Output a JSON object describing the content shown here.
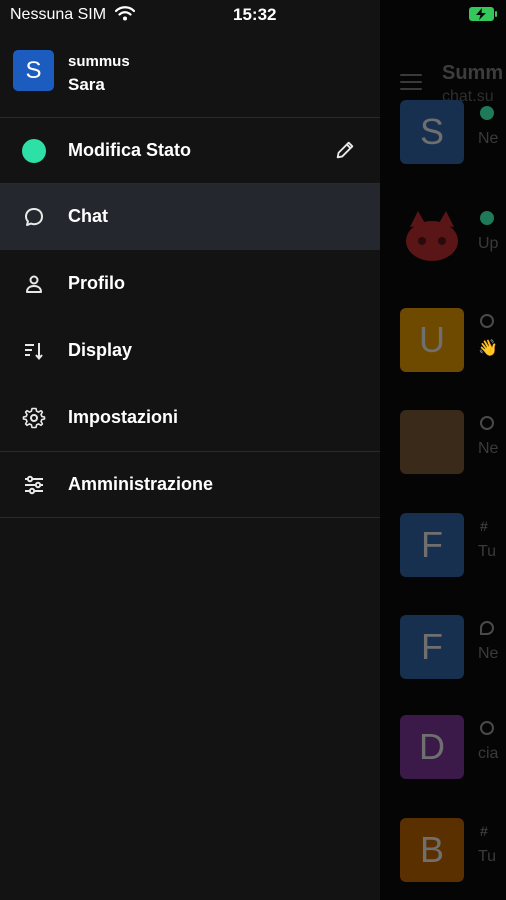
{
  "status_bar": {
    "carrier": "Nessuna SIM",
    "time": "15:32",
    "battery_color": "#34c759"
  },
  "drawer": {
    "avatar_letter": "S",
    "avatar_color": "#1d5cbf",
    "server_name": "summus",
    "username": "Sara",
    "status_item": {
      "label": "Modifica Stato",
      "status_color": "#2de0a5",
      "icon": "pencil-icon"
    },
    "items": [
      {
        "label": "Chat",
        "icon": "chat-bubble-icon",
        "active": true
      },
      {
        "label": "Profilo",
        "icon": "user-icon",
        "active": false
      },
      {
        "label": "Display",
        "icon": "sort-icon",
        "active": false
      },
      {
        "label": "Impostazioni",
        "icon": "gear-icon",
        "active": false
      },
      {
        "label": "Amministrazione",
        "icon": "sliders-icon",
        "active": false
      }
    ]
  },
  "background": {
    "header_title": "Summ",
    "header_subtitle": "chat.su",
    "rows": [
      {
        "letter": "S",
        "color": "#17304f",
        "preview": "Ne"
      },
      {
        "letter": "",
        "color": "#5a1616",
        "preview": "Up"
      },
      {
        "letter": "U",
        "color": "#6e4a00",
        "preview": "👋"
      },
      {
        "letter": "",
        "color": "#3a2a1a",
        "preview": "Ne"
      },
      {
        "letter": "F",
        "color": "#17304f",
        "preview": "Tu"
      },
      {
        "letter": "F",
        "color": "#17304f",
        "preview": "Ne"
      },
      {
        "letter": "D",
        "color": "#3b1a4a",
        "preview": "cia"
      },
      {
        "letter": "B",
        "color": "#5a3000",
        "preview": "Tu"
      }
    ]
  }
}
